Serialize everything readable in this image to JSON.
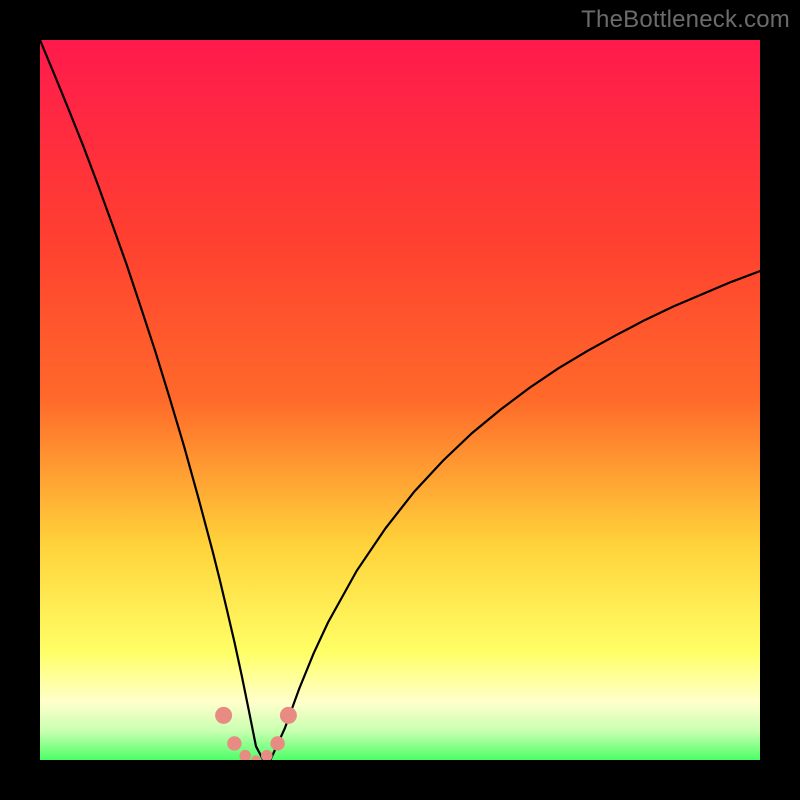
{
  "watermark": "TheBottleneck.com",
  "colors": {
    "bg_frame": "#000000",
    "grad_top": "#ff1a4d",
    "grad_mid1": "#ff6a2a",
    "grad_mid2": "#ffd23a",
    "grad_yellow": "#ffff66",
    "grad_pale": "#ffffcc",
    "grad_green": "#4dff66",
    "curve": "#000000",
    "marker_fill": "#e88b83",
    "marker_stroke": "#c06a62"
  },
  "chart_data": {
    "type": "line",
    "title": "",
    "xlabel": "",
    "ylabel": "",
    "xlim": [
      0,
      100
    ],
    "ylim": [
      0,
      100
    ],
    "x": [
      0,
      2,
      4,
      6,
      8,
      10,
      12,
      14,
      16,
      18,
      20,
      22,
      24,
      25,
      26,
      27,
      28,
      29,
      30,
      31,
      32,
      34,
      36,
      38,
      40,
      44,
      48,
      52,
      56,
      60,
      64,
      68,
      72,
      76,
      80,
      84,
      88,
      92,
      96,
      100
    ],
    "values": [
      100,
      95.2,
      90.3,
      85.3,
      80.0,
      74.5,
      68.9,
      62.9,
      56.8,
      50.3,
      43.6,
      36.4,
      28.9,
      24.9,
      20.7,
      16.4,
      11.8,
      6.9,
      1.9,
      0.0,
      0.0,
      4.4,
      9.9,
      14.8,
      19.1,
      26.3,
      32.2,
      37.3,
      41.6,
      45.4,
      48.7,
      51.7,
      54.4,
      56.8,
      59.0,
      61.1,
      63.0,
      64.7,
      66.4,
      67.9
    ],
    "marker_x": [
      25.5,
      27.0,
      28.5,
      30.0,
      31.5,
      33.0,
      34.5
    ],
    "marker_y": [
      6.2,
      2.3,
      0.6,
      0.0,
      0.6,
      2.3,
      6.2
    ],
    "min_at_x": 30
  }
}
